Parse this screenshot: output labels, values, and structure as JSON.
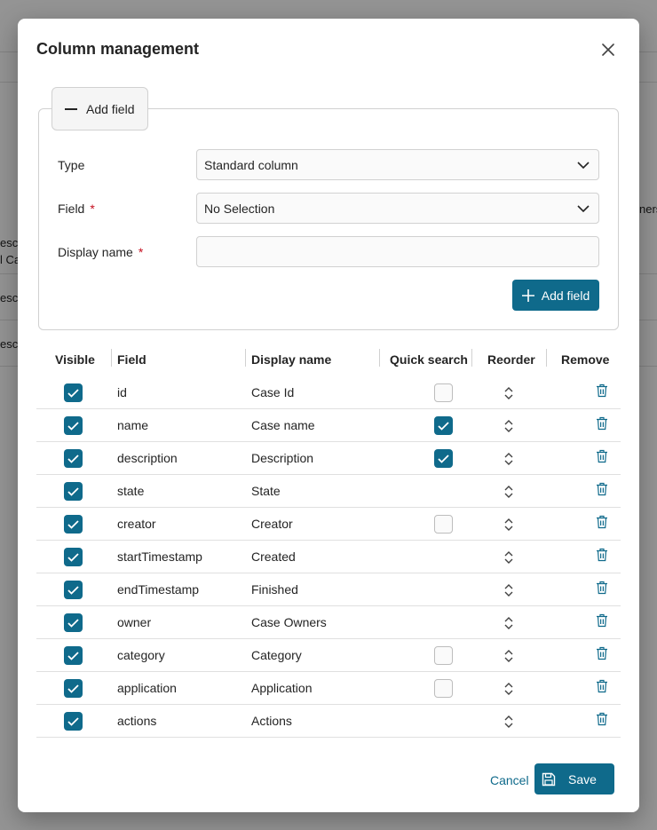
{
  "background": {
    "snippets": [
      "escr",
      "l Ca",
      "escr",
      "escr",
      "ners"
    ]
  },
  "dialog": {
    "title": "Column management",
    "close_icon": "close-icon"
  },
  "add_section": {
    "toggle_label": "Add field",
    "type_label": "Type",
    "type_value": "Standard column",
    "field_label": "Field",
    "field_value": "No Selection",
    "display_name_label": "Display name",
    "display_name_value": "",
    "required_mark": "*",
    "add_button_label": "Add field"
  },
  "table": {
    "headers": {
      "visible": "Visible",
      "field": "Field",
      "display_name": "Display name",
      "quick_search": "Quick search",
      "reorder": "Reorder",
      "remove": "Remove"
    },
    "rows": [
      {
        "visible": true,
        "field": "id",
        "display_name": "Case Id",
        "quick_search": "unchecked"
      },
      {
        "visible": true,
        "field": "name",
        "display_name": "Case name",
        "quick_search": "checked"
      },
      {
        "visible": true,
        "field": "description",
        "display_name": "Description",
        "quick_search": "checked"
      },
      {
        "visible": true,
        "field": "state",
        "display_name": "State",
        "quick_search": "none"
      },
      {
        "visible": true,
        "field": "creator",
        "display_name": "Creator",
        "quick_search": "unchecked"
      },
      {
        "visible": true,
        "field": "startTimestamp",
        "display_name": "Created",
        "quick_search": "none"
      },
      {
        "visible": true,
        "field": "endTimestamp",
        "display_name": "Finished",
        "quick_search": "none"
      },
      {
        "visible": true,
        "field": "owner",
        "display_name": "Case Owners",
        "quick_search": "none"
      },
      {
        "visible": true,
        "field": "category",
        "display_name": "Category",
        "quick_search": "unchecked"
      },
      {
        "visible": true,
        "field": "application",
        "display_name": "Application",
        "quick_search": "unchecked"
      },
      {
        "visible": true,
        "field": "actions",
        "display_name": "Actions",
        "quick_search": "none"
      }
    ]
  },
  "footer": {
    "cancel_label": "Cancel",
    "save_label": "Save"
  },
  "colors": {
    "accent": "#0f6a8b",
    "required": "#c50f1f"
  }
}
